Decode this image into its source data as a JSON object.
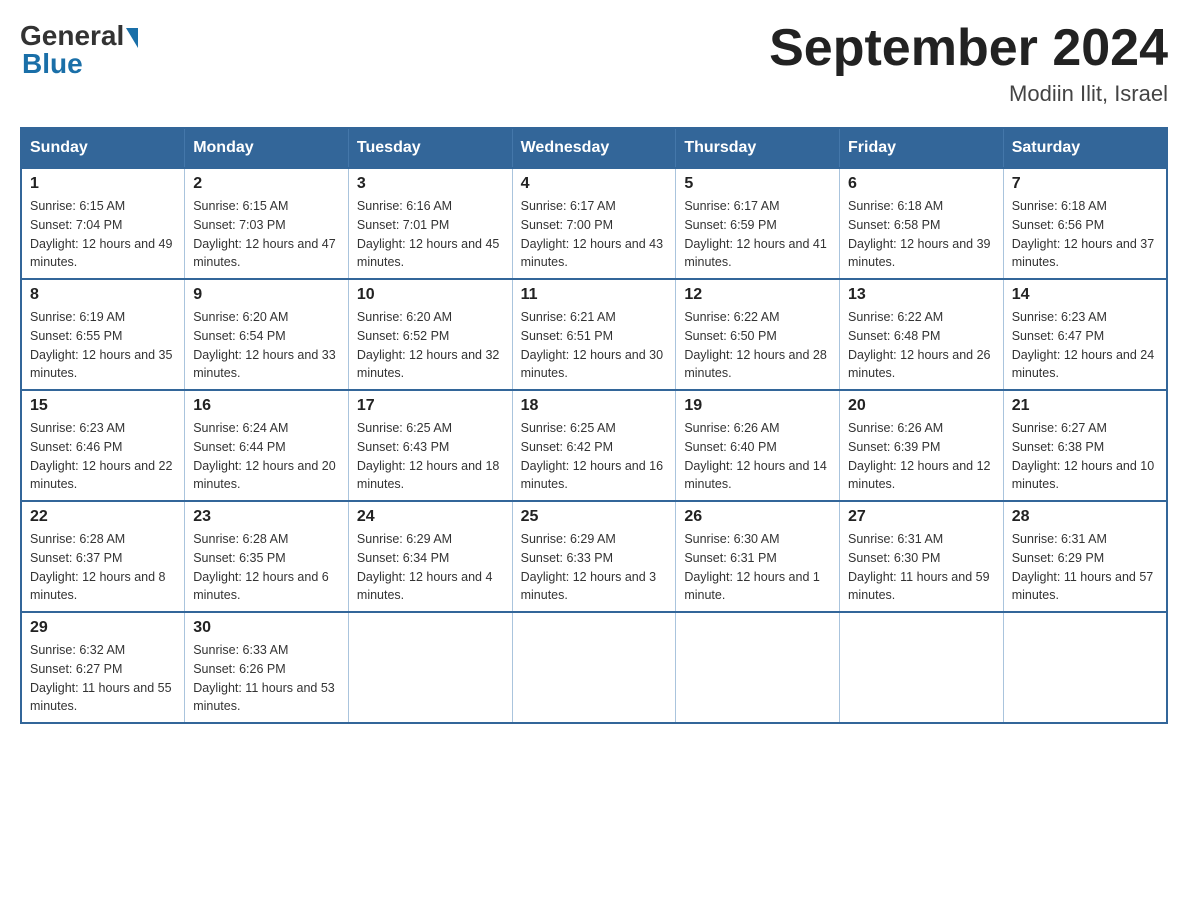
{
  "header": {
    "logo_general": "General",
    "logo_blue": "Blue",
    "month_title": "September 2024",
    "location": "Modiin Ilit, Israel"
  },
  "weekdays": [
    "Sunday",
    "Monday",
    "Tuesday",
    "Wednesday",
    "Thursday",
    "Friday",
    "Saturday"
  ],
  "weeks": [
    [
      {
        "day": "1",
        "sunrise": "Sunrise: 6:15 AM",
        "sunset": "Sunset: 7:04 PM",
        "daylight": "Daylight: 12 hours and 49 minutes."
      },
      {
        "day": "2",
        "sunrise": "Sunrise: 6:15 AM",
        "sunset": "Sunset: 7:03 PM",
        "daylight": "Daylight: 12 hours and 47 minutes."
      },
      {
        "day": "3",
        "sunrise": "Sunrise: 6:16 AM",
        "sunset": "Sunset: 7:01 PM",
        "daylight": "Daylight: 12 hours and 45 minutes."
      },
      {
        "day": "4",
        "sunrise": "Sunrise: 6:17 AM",
        "sunset": "Sunset: 7:00 PM",
        "daylight": "Daylight: 12 hours and 43 minutes."
      },
      {
        "day": "5",
        "sunrise": "Sunrise: 6:17 AM",
        "sunset": "Sunset: 6:59 PM",
        "daylight": "Daylight: 12 hours and 41 minutes."
      },
      {
        "day": "6",
        "sunrise": "Sunrise: 6:18 AM",
        "sunset": "Sunset: 6:58 PM",
        "daylight": "Daylight: 12 hours and 39 minutes."
      },
      {
        "day": "7",
        "sunrise": "Sunrise: 6:18 AM",
        "sunset": "Sunset: 6:56 PM",
        "daylight": "Daylight: 12 hours and 37 minutes."
      }
    ],
    [
      {
        "day": "8",
        "sunrise": "Sunrise: 6:19 AM",
        "sunset": "Sunset: 6:55 PM",
        "daylight": "Daylight: 12 hours and 35 minutes."
      },
      {
        "day": "9",
        "sunrise": "Sunrise: 6:20 AM",
        "sunset": "Sunset: 6:54 PM",
        "daylight": "Daylight: 12 hours and 33 minutes."
      },
      {
        "day": "10",
        "sunrise": "Sunrise: 6:20 AM",
        "sunset": "Sunset: 6:52 PM",
        "daylight": "Daylight: 12 hours and 32 minutes."
      },
      {
        "day": "11",
        "sunrise": "Sunrise: 6:21 AM",
        "sunset": "Sunset: 6:51 PM",
        "daylight": "Daylight: 12 hours and 30 minutes."
      },
      {
        "day": "12",
        "sunrise": "Sunrise: 6:22 AM",
        "sunset": "Sunset: 6:50 PM",
        "daylight": "Daylight: 12 hours and 28 minutes."
      },
      {
        "day": "13",
        "sunrise": "Sunrise: 6:22 AM",
        "sunset": "Sunset: 6:48 PM",
        "daylight": "Daylight: 12 hours and 26 minutes."
      },
      {
        "day": "14",
        "sunrise": "Sunrise: 6:23 AM",
        "sunset": "Sunset: 6:47 PM",
        "daylight": "Daylight: 12 hours and 24 minutes."
      }
    ],
    [
      {
        "day": "15",
        "sunrise": "Sunrise: 6:23 AM",
        "sunset": "Sunset: 6:46 PM",
        "daylight": "Daylight: 12 hours and 22 minutes."
      },
      {
        "day": "16",
        "sunrise": "Sunrise: 6:24 AM",
        "sunset": "Sunset: 6:44 PM",
        "daylight": "Daylight: 12 hours and 20 minutes."
      },
      {
        "day": "17",
        "sunrise": "Sunrise: 6:25 AM",
        "sunset": "Sunset: 6:43 PM",
        "daylight": "Daylight: 12 hours and 18 minutes."
      },
      {
        "day": "18",
        "sunrise": "Sunrise: 6:25 AM",
        "sunset": "Sunset: 6:42 PM",
        "daylight": "Daylight: 12 hours and 16 minutes."
      },
      {
        "day": "19",
        "sunrise": "Sunrise: 6:26 AM",
        "sunset": "Sunset: 6:40 PM",
        "daylight": "Daylight: 12 hours and 14 minutes."
      },
      {
        "day": "20",
        "sunrise": "Sunrise: 6:26 AM",
        "sunset": "Sunset: 6:39 PM",
        "daylight": "Daylight: 12 hours and 12 minutes."
      },
      {
        "day": "21",
        "sunrise": "Sunrise: 6:27 AM",
        "sunset": "Sunset: 6:38 PM",
        "daylight": "Daylight: 12 hours and 10 minutes."
      }
    ],
    [
      {
        "day": "22",
        "sunrise": "Sunrise: 6:28 AM",
        "sunset": "Sunset: 6:37 PM",
        "daylight": "Daylight: 12 hours and 8 minutes."
      },
      {
        "day": "23",
        "sunrise": "Sunrise: 6:28 AM",
        "sunset": "Sunset: 6:35 PM",
        "daylight": "Daylight: 12 hours and 6 minutes."
      },
      {
        "day": "24",
        "sunrise": "Sunrise: 6:29 AM",
        "sunset": "Sunset: 6:34 PM",
        "daylight": "Daylight: 12 hours and 4 minutes."
      },
      {
        "day": "25",
        "sunrise": "Sunrise: 6:29 AM",
        "sunset": "Sunset: 6:33 PM",
        "daylight": "Daylight: 12 hours and 3 minutes."
      },
      {
        "day": "26",
        "sunrise": "Sunrise: 6:30 AM",
        "sunset": "Sunset: 6:31 PM",
        "daylight": "Daylight: 12 hours and 1 minute."
      },
      {
        "day": "27",
        "sunrise": "Sunrise: 6:31 AM",
        "sunset": "Sunset: 6:30 PM",
        "daylight": "Daylight: 11 hours and 59 minutes."
      },
      {
        "day": "28",
        "sunrise": "Sunrise: 6:31 AM",
        "sunset": "Sunset: 6:29 PM",
        "daylight": "Daylight: 11 hours and 57 minutes."
      }
    ],
    [
      {
        "day": "29",
        "sunrise": "Sunrise: 6:32 AM",
        "sunset": "Sunset: 6:27 PM",
        "daylight": "Daylight: 11 hours and 55 minutes."
      },
      {
        "day": "30",
        "sunrise": "Sunrise: 6:33 AM",
        "sunset": "Sunset: 6:26 PM",
        "daylight": "Daylight: 11 hours and 53 minutes."
      },
      null,
      null,
      null,
      null,
      null
    ]
  ]
}
